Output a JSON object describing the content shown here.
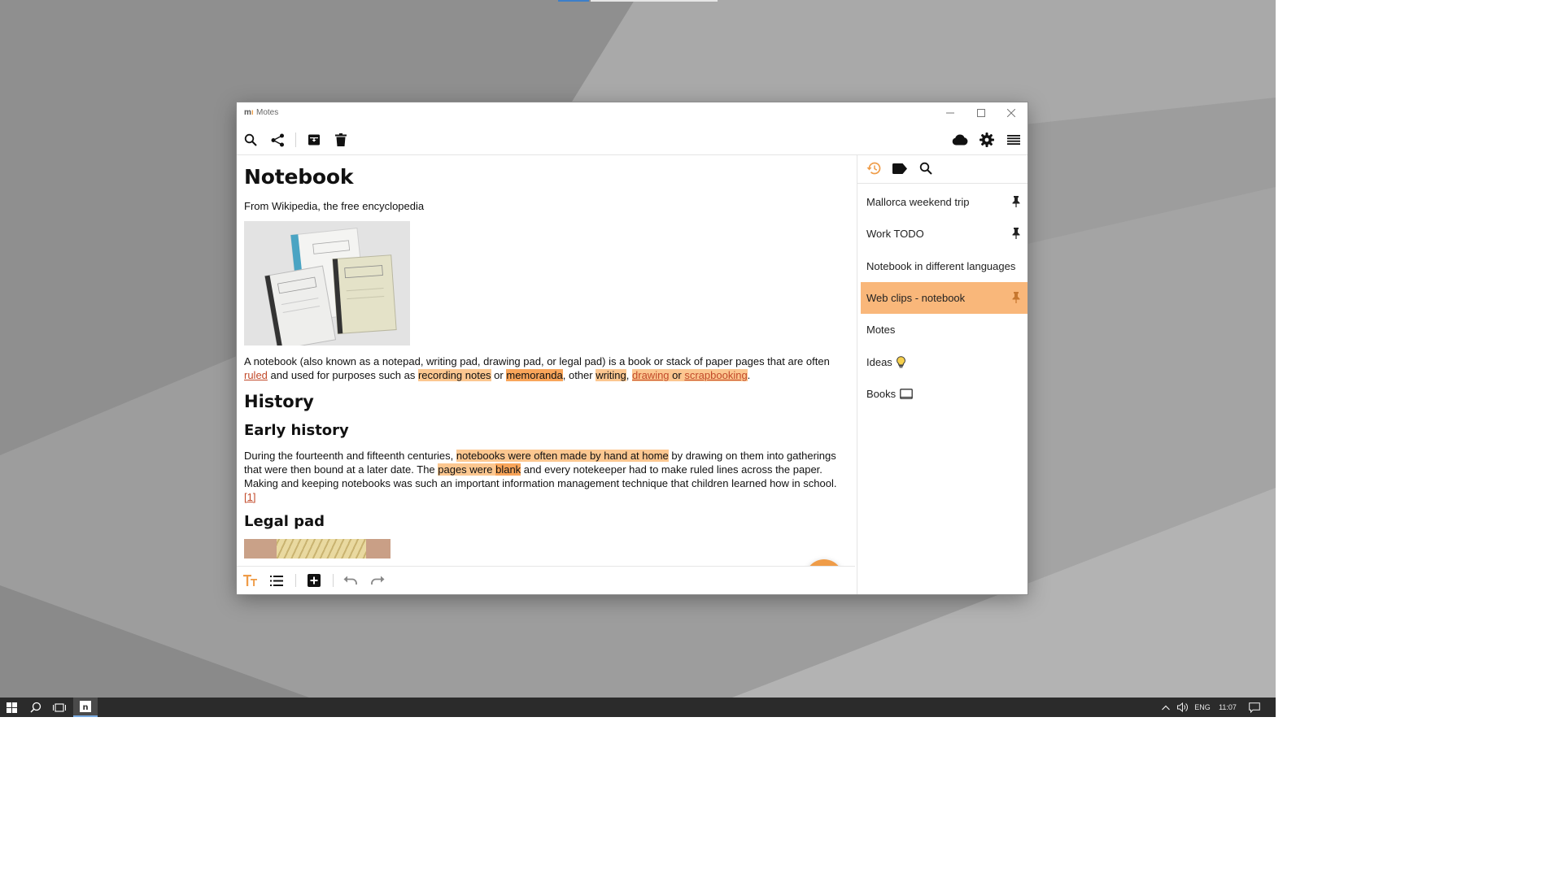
{
  "window": {
    "app_name": "Motes",
    "logo_text": "m"
  },
  "toolbar": {
    "left_icons": [
      "search-icon",
      "share-icon",
      "archive-icon",
      "delete-icon"
    ],
    "right_icons": [
      "cloud-sync-icon",
      "settings-icon",
      "menu-icon"
    ]
  },
  "note": {
    "title": "Notebook",
    "subtitle": "From Wikipedia, the free encyclopedia",
    "intro": {
      "t1": "A notebook (also known as a notepad, writing pad, drawing pad, or legal pad) is a book or stack of paper pages that are often ",
      "link_ruled": "ruled",
      "t2": " and used for purposes such as ",
      "hl_recording": "recording notes",
      "t3": " or ",
      "hl_memoranda": "memoranda",
      "t4": ", other ",
      "hl_writing": "writing",
      "t5": ", ",
      "link_drawing": "drawing",
      "t6": " or ",
      "link_scrapbooking": "scrapbooking",
      "t7": "."
    },
    "h_history": "History",
    "h_early": "Early history",
    "early": {
      "t1": "During the fourteenth and fifteenth centuries, ",
      "hl_made": "notebooks were often made by hand at home",
      "t2": " by drawing on them into gatherings that were then bound at a later date. The ",
      "hl_pages": "pages were ",
      "hl_blank": "blank",
      "t3": " and every notekeeper had to make ruled lines across the paper. Making and keeping notebooks was such an important information management technique that children learned how in school.",
      "ref": "[1]"
    },
    "h_legal": "Legal pad"
  },
  "sidebar": {
    "tabs": [
      "history-icon",
      "tag-icon",
      "search-icon"
    ],
    "notes": [
      {
        "label": "Mallorca weekend trip",
        "pinned": true,
        "active": false
      },
      {
        "label": "Work TODO",
        "pinned": true,
        "active": false
      },
      {
        "label": "Notebook in different languages",
        "pinned": false,
        "active": false
      },
      {
        "label": "Web clips - notebook",
        "pinned": true,
        "active": true
      },
      {
        "label": "Motes",
        "pinned": false,
        "active": false
      },
      {
        "label": "Ideas",
        "pinned": false,
        "active": false,
        "emoji": "lightbulb-icon"
      },
      {
        "label": "Books",
        "pinned": false,
        "active": false,
        "emoji": "book-icon"
      }
    ]
  },
  "bottombar": {
    "icons": [
      "text-format-icon",
      "list-icon",
      "add-block-icon",
      "undo-icon",
      "redo-icon"
    ]
  },
  "taskbar": {
    "language": "ENG",
    "time": "11:07"
  },
  "colors": {
    "accent": "#ef9c48",
    "highlight": "#fcc790",
    "highlight_strong": "#f9a55a",
    "active_note": "#f9b77a"
  }
}
